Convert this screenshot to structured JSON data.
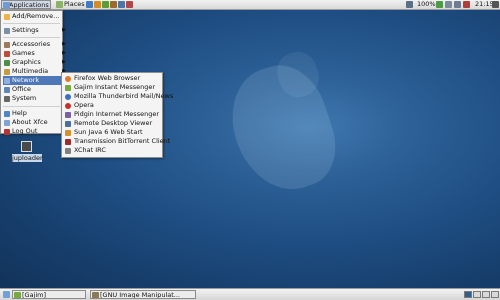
{
  "top_panel": {
    "applications": "Applications",
    "places": "Places",
    "battery": "100%",
    "time": "21:15"
  },
  "app_menu": {
    "items": [
      {
        "label": "Add/Remove..."
      },
      {
        "label": "Settings"
      },
      {
        "label": "Accessories"
      },
      {
        "label": "Games"
      },
      {
        "label": "Graphics"
      },
      {
        "label": "Multimedia"
      },
      {
        "label": "Network"
      },
      {
        "label": "Office"
      },
      {
        "label": "System"
      },
      {
        "label": "Help"
      },
      {
        "label": "About Xfce"
      },
      {
        "label": "Log Out"
      }
    ]
  },
  "network_submenu": {
    "items": [
      {
        "label": "Firefox Web Browser"
      },
      {
        "label": "Gajim Instant Messenger"
      },
      {
        "label": "Mozilla Thunderbird Mail/News"
      },
      {
        "label": "Opera"
      },
      {
        "label": "Pidgin Internet Messenger"
      },
      {
        "label": "Remote Desktop Viewer"
      },
      {
        "label": "Sun Java 6 Web Start"
      },
      {
        "label": "Transmission BitTorrent Client"
      },
      {
        "label": "XChat IRC"
      }
    ]
  },
  "desktop": {
    "icon_label": "juploader"
  },
  "bottom_panel": {
    "task1": "[Gajim]",
    "task2": "[GNU Image Manipulat..."
  },
  "colors": {
    "selection": "#4d77b6",
    "desktop": "#1f4f85"
  }
}
